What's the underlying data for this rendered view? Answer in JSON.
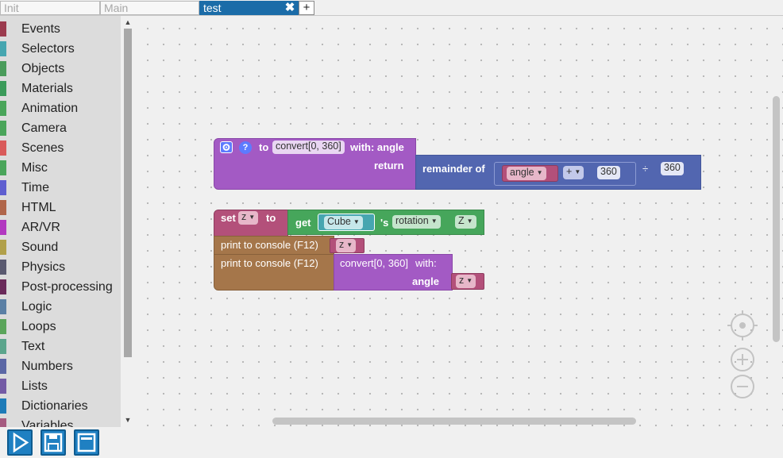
{
  "tabs": [
    {
      "label": "Init"
    },
    {
      "label": "Main"
    },
    {
      "label": "test",
      "close_icon": "✖"
    }
  ],
  "add_tab_label": "+",
  "toolbox": {
    "categories": [
      {
        "label": "Events",
        "color": "#9b3b4e"
      },
      {
        "label": "Selectors",
        "color": "#46a6b0"
      },
      {
        "label": "Objects",
        "color": "#4a9c5b"
      },
      {
        "label": "Materials",
        "color": "#3b9b5a"
      },
      {
        "label": "Animation",
        "color": "#4aa55a"
      },
      {
        "label": "Camera",
        "color": "#4aa55a"
      },
      {
        "label": "Scenes",
        "color": "#d95a5a"
      },
      {
        "label": "Misc",
        "color": "#4aa55a"
      },
      {
        "label": "Time",
        "color": "#5f5fd0"
      },
      {
        "label": "HTML",
        "color": "#b0664a"
      },
      {
        "label": "AR/VR",
        "color": "#b238c0"
      },
      {
        "label": "Sound",
        "color": "#b1a04a"
      },
      {
        "label": "Physics",
        "color": "#5a5a70"
      },
      {
        "label": "Post-processing",
        "color": "#6a2a5a"
      },
      {
        "label": "Logic",
        "color": "#5b80a5"
      },
      {
        "label": "Loops",
        "color": "#5ba55b"
      },
      {
        "label": "Text",
        "color": "#5ba58c"
      },
      {
        "label": "Numbers",
        "color": "#5b67a5"
      },
      {
        "label": "Lists",
        "color": "#745ba5"
      },
      {
        "label": "Dictionaries",
        "color": "#1e7bb8"
      },
      {
        "label": "Variables",
        "color": "#a55b80"
      }
    ],
    "scroll_up_icon": "▲",
    "scroll_down_icon": "▼"
  },
  "workspace": {
    "func_def": {
      "help_label": "?",
      "to": "to",
      "name": "convert[0, 360]",
      "with_label": "with: angle",
      "return_label": "return",
      "remainder_label": "remainder of",
      "var_angle": "angle",
      "plus_op": "+",
      "plus_value": "360",
      "divide_op": "÷",
      "divisor": "360"
    },
    "set_block": {
      "set": "set",
      "var": "z",
      "to": "to",
      "get": "get",
      "object": "Cube",
      "possessive": "'s",
      "property": "rotation",
      "axis": "Z"
    },
    "print1": {
      "label": "print to console (F12)",
      "var": "z"
    },
    "print2": {
      "label": "print to console (F12)",
      "call_name": "convert[0, 360]",
      "call_with": "with:",
      "param": "angle",
      "param_var": "z"
    }
  },
  "colors": {
    "procedure": "#a35ac4",
    "math": "#5266b0",
    "variable": "#b3507a",
    "object": "#46a65b",
    "console": "#a5764a",
    "active_tab": "#1b6ca8",
    "button": "#1f80c2"
  }
}
